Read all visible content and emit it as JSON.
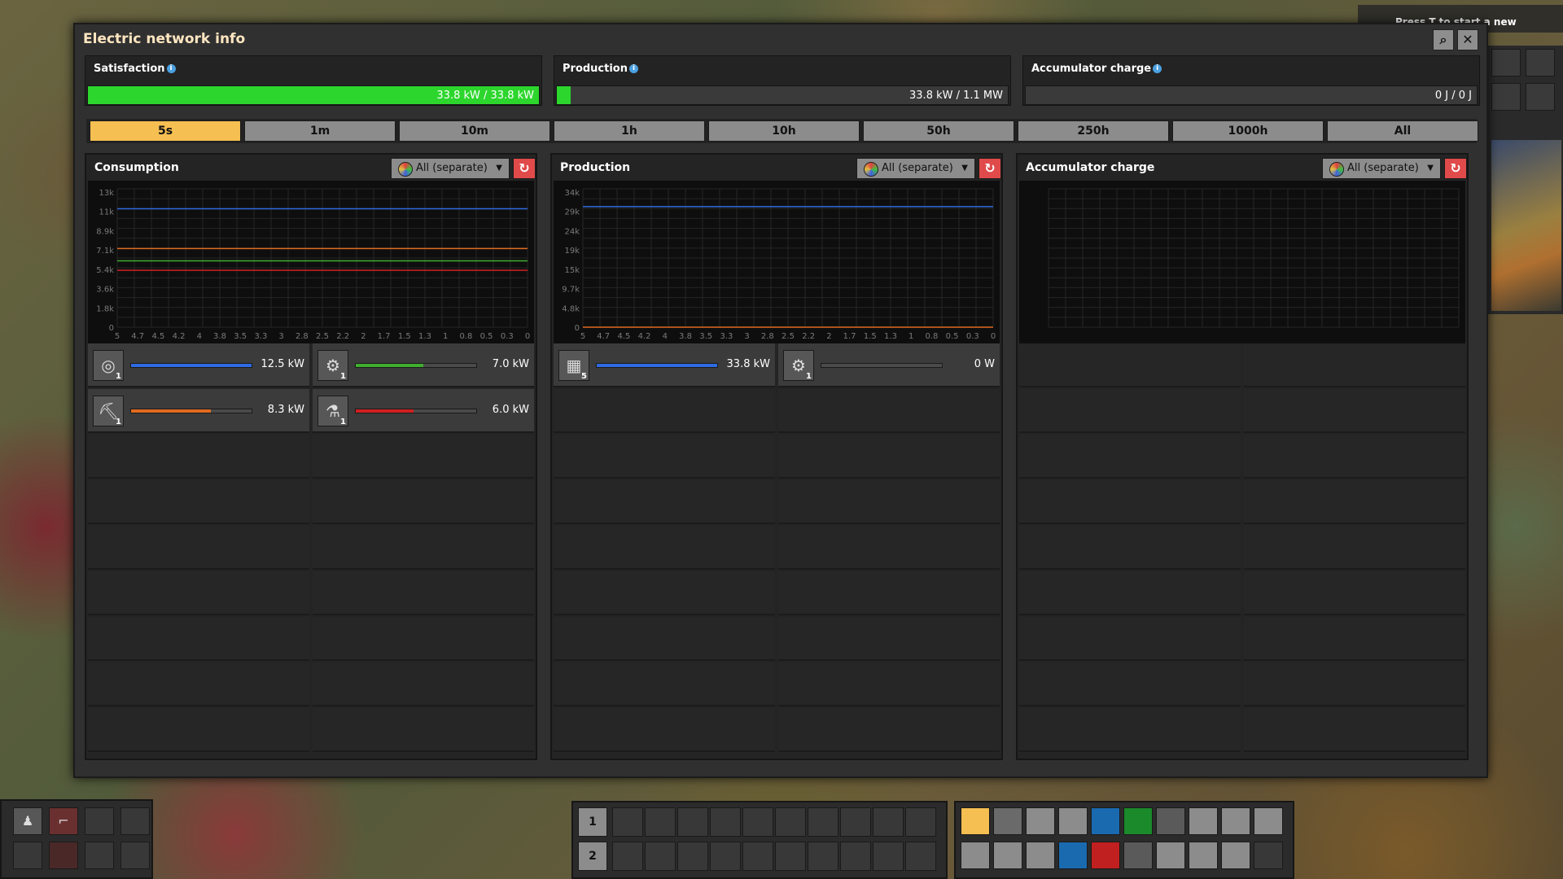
{
  "hint": {
    "text": "Press T to start a new research."
  },
  "window": {
    "title": "Electric network info"
  },
  "summary": {
    "satisfaction": {
      "label": "Satisfaction",
      "value": "33.8 kW / 33.8 kW",
      "fraction": 1.0,
      "color": "#2dd62d"
    },
    "production": {
      "label": "Production",
      "value": "33.8 kW / 1.1 MW",
      "fraction": 0.03,
      "color": "#2dd62d"
    },
    "accumulator": {
      "label": "Accumulator charge",
      "value": "0 J / 0 J",
      "fraction": 0
    }
  },
  "tabs": [
    "5s",
    "1m",
    "10m",
    "1h",
    "10h",
    "50h",
    "250h",
    "1000h",
    "All"
  ],
  "active_tab": "5s",
  "panels": [
    {
      "title": "Consumption",
      "filter": "All (separate)",
      "chart_data": {
        "type": "line",
        "ytick_labels": [
          "13k",
          "11k",
          "8.9k",
          "7.1k",
          "5.4k",
          "3.6k",
          "1.8k",
          "0"
        ],
        "ymax": 14600,
        "xtick_labels": [
          "5",
          "4.7",
          "4.5",
          "4.2",
          "4",
          "3.8",
          "3.5",
          "3.3",
          "3",
          "2.8",
          "2.5",
          "2.2",
          "2",
          "1.7",
          "1.5",
          "1.3",
          "1",
          "0.8",
          "0.5",
          "0.3",
          "0"
        ],
        "series": [
          {
            "color": "#2f6be0",
            "value": 12500
          },
          {
            "color": "#e06a20",
            "value": 8300
          },
          {
            "color": "#3fae2f",
            "value": 7000
          },
          {
            "color": "#d02020",
            "value": 6000
          }
        ]
      },
      "items": [
        {
          "icon": "radar-icon",
          "glyph": "◎",
          "count": "1",
          "value": "12.5 kW",
          "fraction": 1.0,
          "color": "#2f6be0"
        },
        {
          "icon": "assembler-icon",
          "glyph": "⚙",
          "count": "1",
          "value": "7.0 kW",
          "fraction": 0.56,
          "color": "#3fae2f"
        },
        {
          "icon": "mining-drill-icon",
          "glyph": "⛏",
          "count": "1",
          "value": "8.3 kW",
          "fraction": 0.66,
          "color": "#e06a20"
        },
        {
          "icon": "lab-icon",
          "glyph": "⚗",
          "count": "1",
          "value": "6.0 kW",
          "fraction": 0.48,
          "color": "#d02020"
        }
      ]
    },
    {
      "title": "Production",
      "filter": "All (separate)",
      "chart_data": {
        "type": "line",
        "ytick_labels": [
          "34k",
          "29k",
          "24k",
          "19k",
          "15k",
          "9.7k",
          "4.8k",
          "0"
        ],
        "ymax": 38800,
        "xtick_labels": [
          "5",
          "4.7",
          "4.5",
          "4.2",
          "4",
          "3.8",
          "3.5",
          "3.3",
          "3",
          "2.8",
          "2.5",
          "2.2",
          "2",
          "1.7",
          "1.5",
          "1.3",
          "1",
          "0.8",
          "0.5",
          "0.3",
          "0"
        ],
        "series": [
          {
            "color": "#2f6be0",
            "value": 33800
          },
          {
            "color": "#e06a20",
            "value": 0
          }
        ]
      },
      "items": [
        {
          "icon": "solar-panel-icon",
          "glyph": "▦",
          "count": "5",
          "value": "33.8 kW",
          "fraction": 1.0,
          "color": "#2f6be0"
        },
        {
          "icon": "steam-engine-icon",
          "glyph": "⚙",
          "count": "1",
          "value": "0 W",
          "fraction": 0,
          "color": "#e06a20"
        }
      ]
    },
    {
      "title": "Accumulator charge",
      "filter": "All (separate)",
      "chart_data": {
        "type": "line",
        "ytick_labels": [],
        "xtick_labels": [],
        "series": []
      },
      "items": []
    }
  ],
  "quickbar": {
    "row1": "1",
    "row2": "2"
  },
  "colors": {
    "panel": "#242424",
    "accent": "#f6bf52",
    "reset": "#e04a4a"
  }
}
